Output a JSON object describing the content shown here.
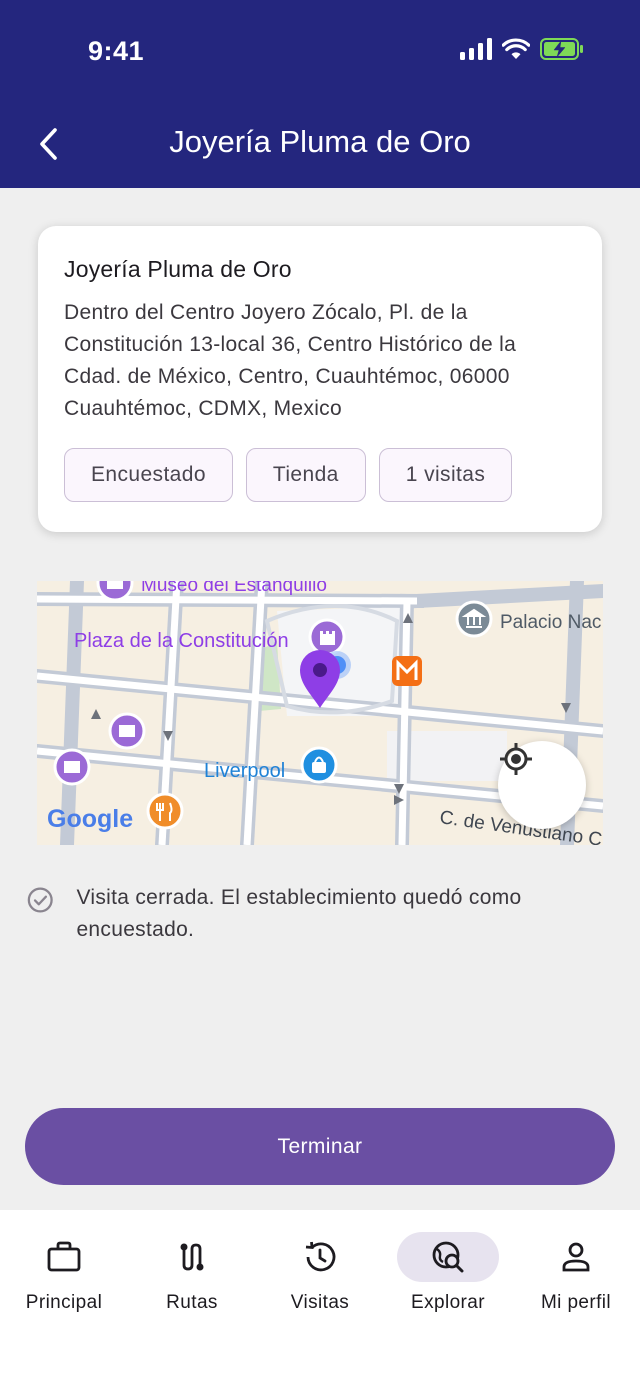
{
  "status_bar": {
    "time": "9:41"
  },
  "header": {
    "title": "Joyería Pluma de Oro"
  },
  "store": {
    "name": "Joyería Pluma de Oro",
    "address": "Dentro del Centro Joyero Zócalo, Pl. de la Constitución 13-local 36, Centro Histórico de la Cdad. de México, Centro, Cuauhtémoc, 06000 Cuauhtémoc, CDMX, Mexico",
    "chips": [
      "Encuestado",
      "Tienda",
      "1 visitas"
    ]
  },
  "map": {
    "labels": {
      "museum": "Museo del Estanquillo",
      "plaza": "Plaza de la Constitución",
      "palacio": "Palacio Nac",
      "liverpool": "Liverpool",
      "street": "C. de Venustiano C",
      "google": "Google"
    },
    "colors": {
      "pin": "#8e3ee6",
      "poi": "#9b6ad6",
      "road": "#c3cad6"
    }
  },
  "visit_message": "Visita cerrada. El establecimiento quedó como encuestado.",
  "finish_button": "Terminar",
  "nav": {
    "items": [
      {
        "label": "Principal",
        "icon": "briefcase-icon"
      },
      {
        "label": "Rutas",
        "icon": "route-icon"
      },
      {
        "label": "Visitas",
        "icon": "history-icon"
      },
      {
        "label": "Explorar",
        "icon": "explore-icon"
      },
      {
        "label": "Mi perfil",
        "icon": "person-icon"
      }
    ],
    "active": "Explorar"
  },
  "colors": {
    "header_bg": "#24267e",
    "primary_button": "#6a4fa3",
    "background": "#efefef"
  }
}
